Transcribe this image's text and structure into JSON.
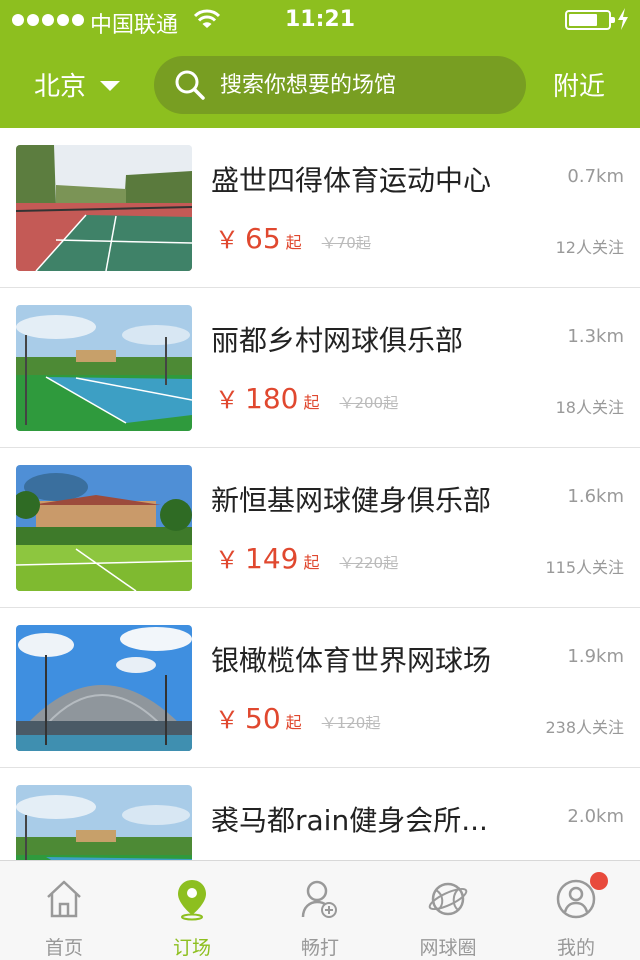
{
  "status": {
    "carrier": "中国联通",
    "time": "11:21"
  },
  "header": {
    "city": "北京",
    "search_placeholder": "搜索你想要的场馆",
    "nearby": "附近"
  },
  "colors": {
    "brand": "#8dbf1f",
    "price": "#e0482f",
    "badge": "#e84a3c"
  },
  "venues": [
    {
      "name": "盛世四得体育运动中心",
      "distance": "0.7km",
      "yen": "￥",
      "price": "65",
      "qi": "起",
      "original": "￥70起",
      "followers": "12人关注"
    },
    {
      "name": "丽都乡村网球俱乐部",
      "distance": "1.3km",
      "yen": "￥",
      "price": "180",
      "qi": "起",
      "original": "￥200起",
      "followers": "18人关注"
    },
    {
      "name": "新恒基网球健身俱乐部",
      "distance": "1.6km",
      "yen": "￥",
      "price": "149",
      "qi": "起",
      "original": "￥220起",
      "followers": "115人关注"
    },
    {
      "name": "银橄榄体育世界网球场",
      "distance": "1.9km",
      "yen": "￥",
      "price": "50",
      "qi": "起",
      "original": "￥120起",
      "followers": "238人关注"
    },
    {
      "name": "裘马都rain健身会所...",
      "distance": "2.0km"
    }
  ],
  "tabs": [
    {
      "label": "首页",
      "icon": "home-icon"
    },
    {
      "label": "订场",
      "icon": "location-pin-icon",
      "active": true
    },
    {
      "label": "畅打",
      "icon": "player-add-icon"
    },
    {
      "label": "网球圈",
      "icon": "tennis-ball-icon"
    },
    {
      "label": "我的",
      "icon": "profile-icon",
      "badge": true
    }
  ]
}
